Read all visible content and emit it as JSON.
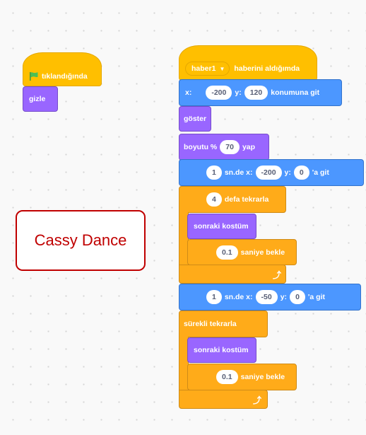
{
  "left_script": {
    "flag_hat": {
      "label": "tıklandığında",
      "flag_color": "#4cbf56"
    },
    "hide": "gizle"
  },
  "note": {
    "text": "Cassy Dance"
  },
  "main_script": {
    "receive_hat": {
      "message": "haber1",
      "suffix": "haberini aldığımda"
    },
    "goto_xy": {
      "x_label": "x:",
      "x": "-200",
      "y_label": "y:",
      "y": "120",
      "suffix": "konumuna git"
    },
    "show": "göster",
    "set_size": {
      "prefix": "boyutu %",
      "value": "70",
      "suffix": "yap"
    },
    "glide1": {
      "secs": "1",
      "mid": "sn.de x:",
      "x": "-200",
      "y_label": "y:",
      "y": "0",
      "suffix": "'a git"
    },
    "repeat": {
      "count": "4",
      "suffix": "defa tekrarla"
    },
    "next_costume_1": "sonraki kostüm",
    "wait_1": {
      "value": "0.1",
      "suffix": "saniye bekle"
    },
    "glide2": {
      "secs": "1",
      "mid": "sn.de x:",
      "x": "-50",
      "y_label": "y:",
      "y": "0",
      "suffix": "'a git"
    },
    "forever": "sürekli tekrarla",
    "next_costume_2": "sonraki kostüm",
    "wait_2": {
      "value": "0.1",
      "suffix": "saniye bekle"
    }
  },
  "colors": {
    "events": "#ffbf00",
    "motion": "#4c97ff",
    "looks": "#9966ff",
    "control": "#ffab19",
    "note_border": "#c00000"
  }
}
